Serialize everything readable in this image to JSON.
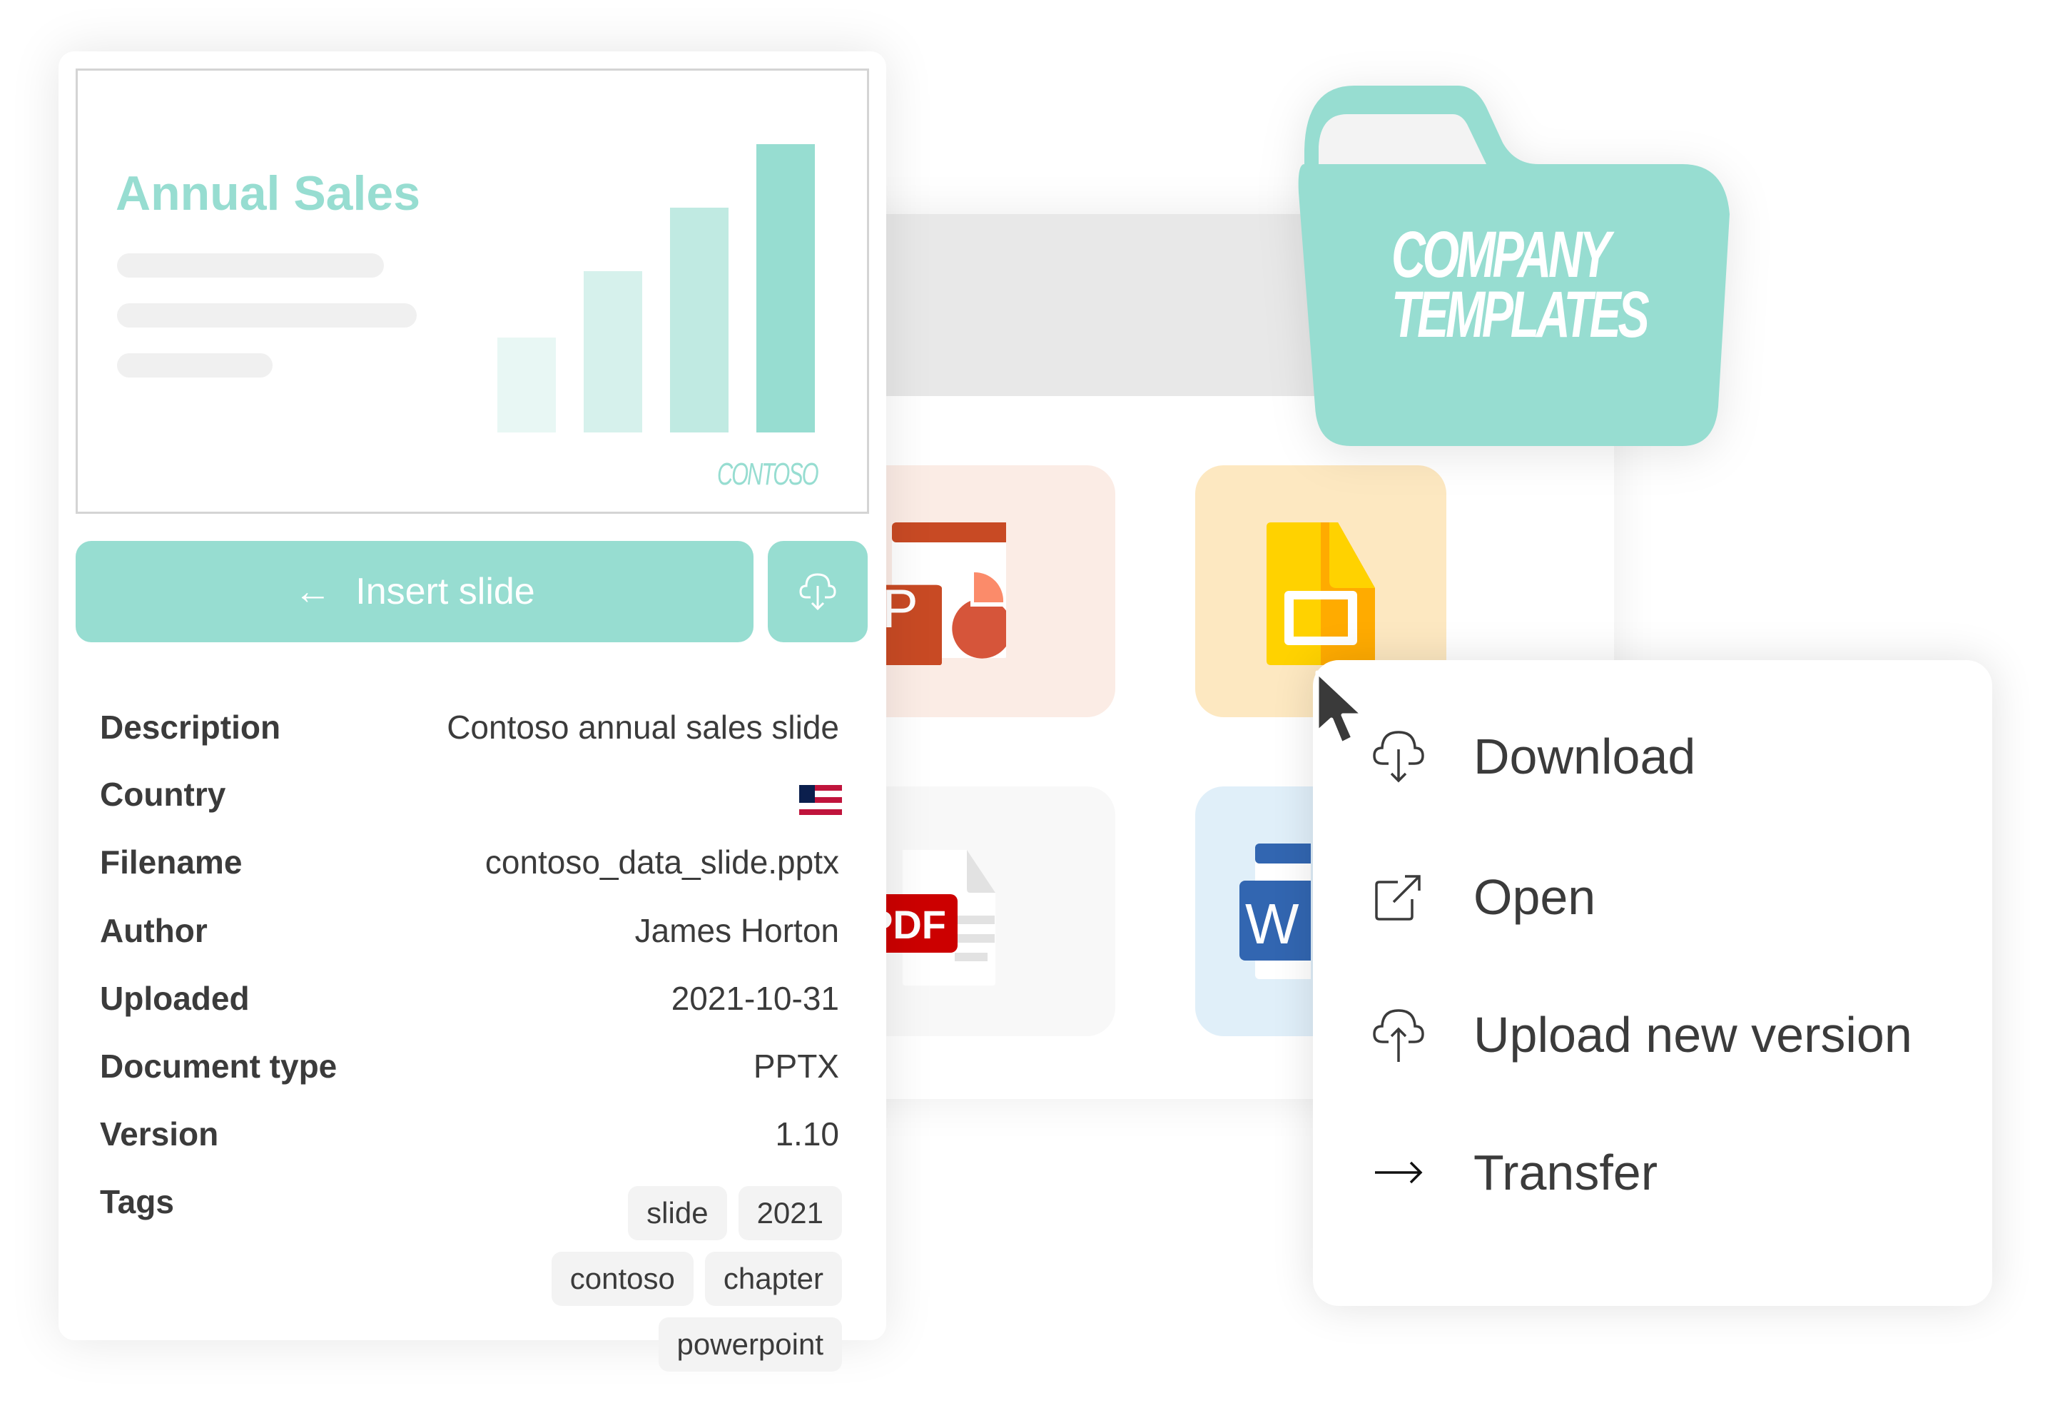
{
  "colors": {
    "accent": "#97ddd1",
    "text": "#3b3b3b",
    "ppt_tile": "#fbece5",
    "slides_tile": "#fde8c1",
    "pdf_tile": "#f8f8f8",
    "word_tile": "#e0eff9"
  },
  "folder": {
    "line1": "COMPANY",
    "line2": "TEMPLATES"
  },
  "preview": {
    "title": "Annual Sales",
    "logo": "CONTOSO",
    "bars": [
      {
        "value": 0.33,
        "color": "#e8f7f4"
      },
      {
        "value": 0.56,
        "color": "#d6f1ec"
      },
      {
        "value": 0.78,
        "color": "#c0eae2"
      },
      {
        "value": 1.0,
        "color": "#97ddd1"
      }
    ]
  },
  "actions": {
    "insert_label": "Insert slide",
    "insert_icon": "arrow-left-icon",
    "download_icon": "cloud-download-icon"
  },
  "details": [
    {
      "label": "Description",
      "value": "Contoso annual sales slide"
    },
    {
      "label": "Country",
      "value": "",
      "icon": "us-flag-icon"
    },
    {
      "label": "Filename",
      "value": "contoso_data_slide.pptx"
    },
    {
      "label": "Author",
      "value": "James Horton"
    },
    {
      "label": "Uploaded",
      "value": "2021-10-31"
    },
    {
      "label": "Document type",
      "value": "PPTX"
    },
    {
      "label": "Version",
      "value": "1.10"
    },
    {
      "label": "Tags",
      "value": ""
    }
  ],
  "tags": [
    "slide",
    "2021",
    "contoso",
    "chapter",
    "powerpoint"
  ],
  "files": [
    {
      "type": "powerpoint",
      "icon": "powerpoint-icon",
      "letter": "P"
    },
    {
      "type": "google-slides",
      "icon": "google-slides-icon"
    },
    {
      "type": "pdf",
      "icon": "pdf-icon",
      "badge": "PDF"
    },
    {
      "type": "word",
      "icon": "word-icon",
      "letter": "W"
    }
  ],
  "context_menu": [
    {
      "label": "Download",
      "icon": "cloud-download-icon"
    },
    {
      "label": "Open",
      "icon": "external-link-icon"
    },
    {
      "label": "Upload new version",
      "icon": "cloud-upload-icon"
    },
    {
      "label": "Transfer",
      "icon": "arrow-right-icon"
    }
  ]
}
